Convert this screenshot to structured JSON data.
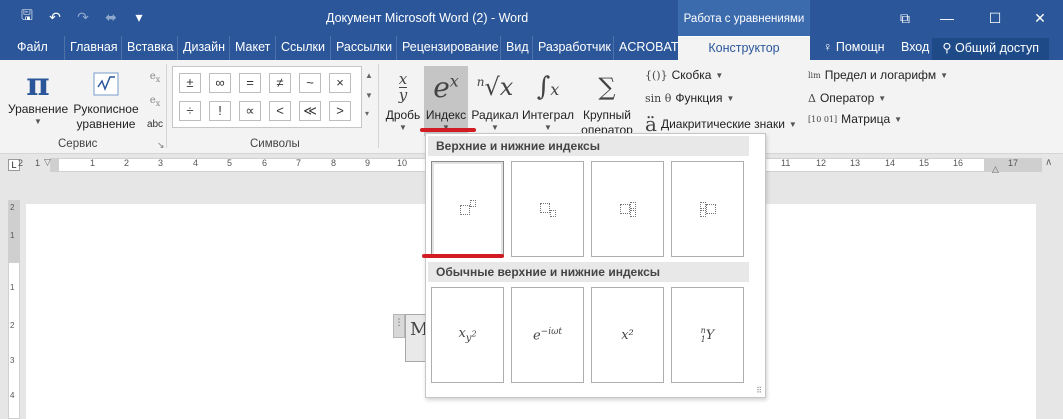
{
  "window": {
    "title": "Документ Microsoft Word (2) - Word",
    "context_tab_group": "Работа с уравнениями",
    "controls": {
      "restore": "⧉",
      "minimize": "—",
      "maximize": "☐",
      "close": "✕"
    }
  },
  "quick_access": {
    "save": "🖫",
    "undo": "↶",
    "redo": "↷",
    "touch": "⬌",
    "customize": "▾"
  },
  "tabs": [
    "Файл",
    "Главная",
    "Вставка",
    "Дизайн",
    "Макет",
    "Ссылки",
    "Рассылки",
    "Рецензирование",
    "Вид",
    "Разработчик",
    "ACROBAT",
    "Конструктор"
  ],
  "active_tab": "Конструктор",
  "tell_me": "Помощн",
  "sign_in": "Вход",
  "share": "Общий доступ",
  "ribbon": {
    "service": {
      "label": "Сервис",
      "equation": "Уравнение",
      "ink_line1": "Рукописное",
      "ink_line2": "уравнение",
      "abc": "abc"
    },
    "symbols": {
      "label": "Символы",
      "row1": [
        "±",
        "∞",
        "=",
        "≠",
        "~",
        "×"
      ],
      "row2": [
        "÷",
        "!",
        "∝",
        "<",
        "≪",
        ">"
      ]
    },
    "structures": {
      "fraction": "Дробь",
      "script": "Индекс",
      "radical": "Радикал",
      "integral": "Интеграл",
      "large_op_line1": "Крупный",
      "large_op_line2": "оператор",
      "bracket": "Скобка",
      "function": "Функция",
      "accent": "Диакритические знаки",
      "limit": "Предел и логарифм",
      "operator": "Оператор",
      "matrix": "Матрица",
      "bracket_icon": "{()}",
      "function_icon": "sin θ",
      "accent_icon": "ä",
      "limit_icon": "lim",
      "operator_icon": "Δ",
      "matrix_icon": "[10 01]"
    }
  },
  "ruler": {
    "numbers": [
      "2",
      "1",
      "1",
      "2",
      "3",
      "4",
      "5",
      "6",
      "7",
      "8",
      "9",
      "10",
      "11",
      "12",
      "13",
      "14",
      "15",
      "16",
      "17"
    ],
    "vertical_numbers": [
      "2",
      "1",
      "1",
      "2",
      "3",
      "4"
    ]
  },
  "gallery": {
    "section1": "Верхние и нижние индексы",
    "section2": "Обычные верхние и нижние индексы",
    "common_items": [
      "x",
      "y",
      "2",
      "e",
      "−iωt",
      "x²",
      "n",
      "1",
      "Y"
    ]
  },
  "equation_placeholder": "M",
  "colors": {
    "title_bar": "#2b579a",
    "highlight": "#d11c24",
    "ribbon_bg": "#f3f3f3"
  }
}
